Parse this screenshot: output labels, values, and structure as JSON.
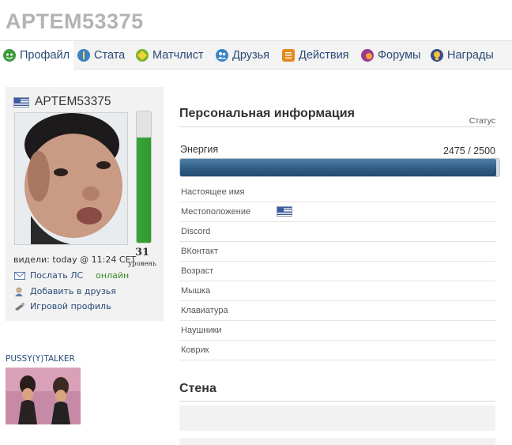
{
  "header": {
    "title": "APTEM53375"
  },
  "tabs": [
    {
      "label": "Профайл",
      "icon": "profile-icon",
      "color": "#3b9b3b"
    },
    {
      "label": "Стата",
      "icon": "stats-icon",
      "color": "#3b82c4"
    },
    {
      "label": "Матчлист",
      "icon": "matchlist-icon",
      "color": "#7bb62b"
    },
    {
      "label": "Друзья",
      "icon": "friends-icon",
      "color": "#3b82c4"
    },
    {
      "label": "Действия",
      "icon": "actions-icon",
      "color": "#e38a1a"
    },
    {
      "label": "Форумы",
      "icon": "forums-icon",
      "color": "#9b3b8f"
    },
    {
      "label": "Награды",
      "icon": "awards-icon",
      "color": "#3b4a8c"
    }
  ],
  "sidebar": {
    "username": "APTEM53375",
    "level": "31",
    "level_label": "уровень",
    "level_progress": 0.8,
    "last_seen": "видели: today @ 11:24 CET",
    "links": {
      "message": "Послать ЛС",
      "online": "онлайн",
      "add_friend": "Добавить в друзья",
      "game_profile": "Игровой профиль"
    }
  },
  "signature": {
    "name": "PUSSY(Y)TALKER"
  },
  "info": {
    "heading": "Персональная информация",
    "status_label": "Статус",
    "energy_label": "Энергия",
    "energy_value": "2475 / 2500",
    "energy_current": 2475,
    "energy_max": 2500,
    "rows": [
      {
        "label": "Настоящее имя",
        "value": ""
      },
      {
        "label": "Местоположение",
        "value": ""
      },
      {
        "label": "Discord",
        "value": ""
      },
      {
        "label": "ВКонтакт",
        "value": ""
      },
      {
        "label": "Возраст",
        "value": ""
      },
      {
        "label": "Мышка",
        "value": ""
      },
      {
        "label": "Клавиатура",
        "value": ""
      },
      {
        "label": "Наушники",
        "value": ""
      },
      {
        "label": "Коврик",
        "value": ""
      }
    ]
  },
  "wall": {
    "heading": "Стена"
  },
  "colors": {
    "link": "#2a4a77",
    "accent_green": "#3ba53b",
    "energy_blue": "#2e5a82"
  }
}
